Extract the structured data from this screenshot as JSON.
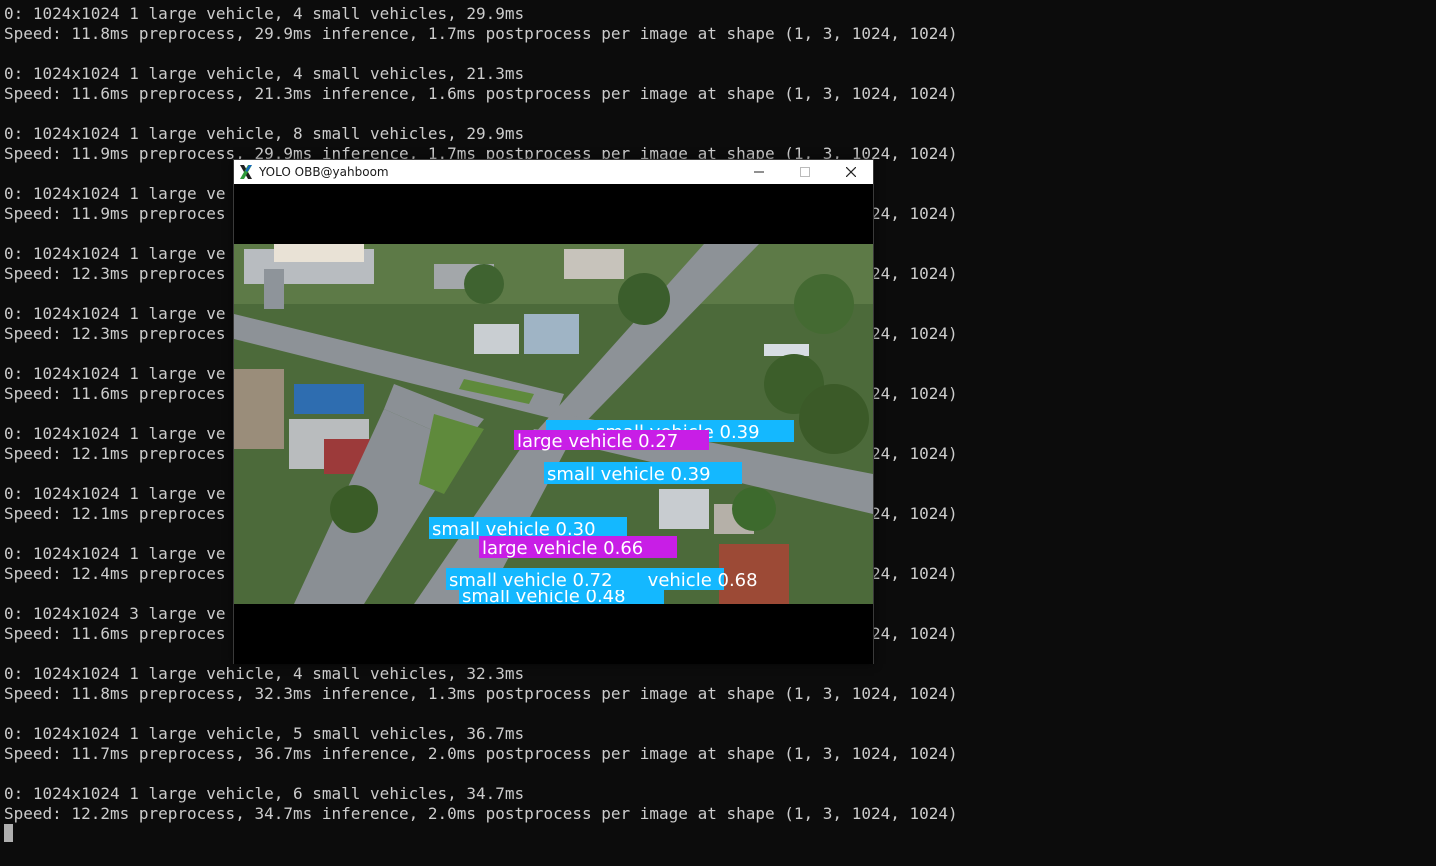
{
  "terminal": {
    "lines": [
      "0: 1024x1024 1 large vehicle, 4 small vehicles, 29.9ms",
      "Speed: 11.8ms preprocess, 29.9ms inference, 1.7ms postprocess per image at shape (1, 3, 1024, 1024)",
      "",
      "0: 1024x1024 1 large vehicle, 4 small vehicles, 21.3ms",
      "Speed: 11.6ms preprocess, 21.3ms inference, 1.6ms postprocess per image at shape (1, 3, 1024, 1024)",
      "",
      "0: 1024x1024 1 large vehicle, 8 small vehicles, 29.9ms",
      "Speed: 11.9ms preprocess, 29.9ms inference, 1.7ms postprocess per image at shape (1, 3, 1024, 1024)",
      "",
      "0: 1024x1024 1 large ve",
      "Speed: 11.9ms preproces                                                                 1024, 1024)",
      "",
      "0: 1024x1024 1 large ve",
      "Speed: 12.3ms preproces                                                                 1024, 1024)",
      "",
      "0: 1024x1024 1 large ve",
      "Speed: 12.3ms preproces                                                                 1024, 1024)",
      "",
      "0: 1024x1024 1 large ve",
      "Speed: 11.6ms preproces                                                                 1024, 1024)",
      "",
      "0: 1024x1024 1 large ve",
      "Speed: 12.1ms preproces                                                                 1024, 1024)",
      "",
      "0: 1024x1024 1 large ve",
      "Speed: 12.1ms preproces                                                                 1024, 1024)",
      "",
      "0: 1024x1024 1 large ve",
      "Speed: 12.4ms preproces                                                                 1024, 1024)",
      "",
      "0: 1024x1024 3 large ve",
      "Speed: 11.6ms preproces                                                                 1024, 1024)",
      "",
      "0: 1024x1024 1 large vehicle, 4 small vehicles, 32.3ms",
      "Speed: 11.8ms preprocess, 32.3ms inference, 1.3ms postprocess per image at shape (1, 3, 1024, 1024)",
      "",
      "0: 1024x1024 1 large vehicle, 5 small vehicles, 36.7ms",
      "Speed: 11.7ms preprocess, 36.7ms inference, 2.0ms postprocess per image at shape (1, 3, 1024, 1024)",
      "",
      "0: 1024x1024 1 large vehicle, 6 small vehicles, 34.7ms",
      "Speed: 12.2ms preprocess, 34.7ms inference, 2.0ms postprocess per image at shape (1, 3, 1024, 1024)"
    ],
    "text_color": "#cccccc",
    "background": "#0c0c0c"
  },
  "window": {
    "title": "YOLO OBB@yahboom",
    "icons": {
      "app": "x-logo-icon",
      "minimize": "minimize-icon",
      "maximize": "maximize-icon",
      "close": "close-icon"
    }
  },
  "detections": [
    {
      "label": "small vehicle 0.39",
      "class": "small vehicle"
    },
    {
      "label": "large vehicle 0.27",
      "class": "large vehicle"
    },
    {
      "label": "small vehicle 0.39",
      "class": "small vehicle"
    },
    {
      "label": "small vehicle 0.30",
      "class": "small vehicle"
    },
    {
      "label": "large vehicle 0.66",
      "class": "large vehicle"
    },
    {
      "label": "small vehicle 0.72",
      "class": "small vehicle"
    },
    {
      "label": "small vehicle 0.68",
      "class": "small vehicle"
    },
    {
      "label": "small vehicle 0.48",
      "class": "small vehicle"
    }
  ],
  "colors": {
    "small_vehicle": "#14b8ff",
    "large_vehicle": "#c81ee6"
  }
}
